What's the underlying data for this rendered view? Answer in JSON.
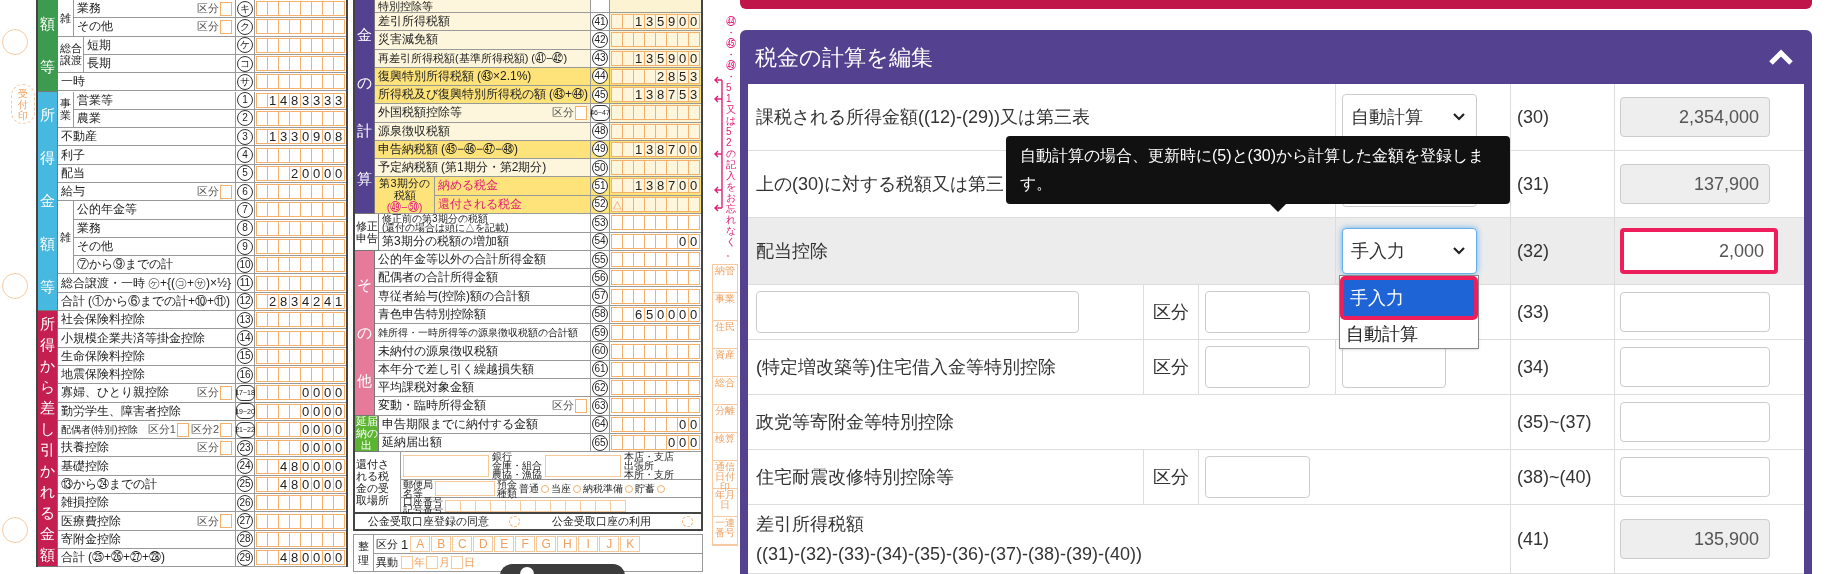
{
  "tax_return_form": {
    "receipt_stamp": "受付印",
    "column_1": [
      {
        "title": "額等",
        "color": "#3d9b4f",
        "kind": "plain",
        "rows": [
          {
            "kind": "group",
            "label": "雑",
            "rows": [
              {
                "kind": "row",
                "label": "業務",
                "kubun": "区分",
                "num": "キ"
              },
              {
                "kind": "row",
                "label": "その他",
                "kubun": "区分",
                "num": "ク"
              }
            ]
          },
          {
            "kind": "group",
            "label": "総合譲渡",
            "rows": [
              {
                "kind": "row",
                "label": "短期",
                "num": "ケ"
              },
              {
                "kind": "row",
                "label": "長期",
                "num": "コ"
              }
            ]
          },
          {
            "kind": "row",
            "label": "一時",
            "num": "サ"
          }
        ]
      },
      {
        "title": "所得金額等",
        "color": "#47b8e0",
        "kind": "plain",
        "rows": [
          {
            "kind": "group",
            "label": "事業",
            "rows": [
              {
                "kind": "row",
                "label": "営業等",
                "num": "1",
                "amount": "1483333"
              },
              {
                "kind": "row",
                "label": "農業",
                "num": "2"
              }
            ]
          },
          {
            "kind": "row",
            "label": "不動産",
            "num": "3",
            "amount": "1330908"
          },
          {
            "kind": "row",
            "label": "利子",
            "num": "4"
          },
          {
            "kind": "row",
            "label": "配当",
            "num": "5",
            "amount": "20000"
          },
          {
            "kind": "row",
            "label": "給与",
            "kubun": "区分",
            "num": "6"
          },
          {
            "kind": "group",
            "label": "雑",
            "rows": [
              {
                "kind": "row",
                "label": "公的年金等",
                "num": "7"
              },
              {
                "kind": "row",
                "label": "業務",
                "num": "8"
              },
              {
                "kind": "row",
                "label": "その他",
                "num": "9"
              },
              {
                "kind": "row",
                "label": "⑦から⑨までの計",
                "num": "10"
              }
            ]
          },
          {
            "kind": "row",
            "label": "総合譲渡・一時",
            "note": "㋘+{(㋙+㋚)×½}",
            "num": "11"
          },
          {
            "kind": "row",
            "label": "合計",
            "note": "(①から⑥までの計+⑩+⑪)",
            "num": "12",
            "amount": "2834241"
          }
        ]
      },
      {
        "title": "所得から差し引かれる金額",
        "color": "#c41f50",
        "kind": "plain",
        "rows": [
          {
            "kind": "row",
            "label": "社会保険料控除",
            "num": "13"
          },
          {
            "kind": "row",
            "label": "小規模企業共済等掛金控除",
            "num": "14"
          },
          {
            "kind": "row",
            "label": "生命保険料控除",
            "num": "15"
          },
          {
            "kind": "row",
            "label": "地震保険料控除",
            "num": "16"
          },
          {
            "kind": "row",
            "label": "寡婦、ひとり親控除",
            "kubun": "区分",
            "num": "17~18",
            "amount": "0000"
          },
          {
            "kind": "row",
            "label": "勤労学生、障害者控除",
            "num": "19~20",
            "amount": "0000"
          },
          {
            "kind": "row",
            "label": "配偶者(特別)控除",
            "kubun": "区分1",
            "kubun_2": "区分2",
            "num": "21~22",
            "amount": "0000"
          },
          {
            "kind": "row",
            "label": "扶養控除",
            "kubun": "区分",
            "num": "23",
            "amount": "0000"
          },
          {
            "kind": "row",
            "label": "基礎控除",
            "num": "24",
            "amount": "480000"
          },
          {
            "kind": "row",
            "label": "⑬から㉔までの計",
            "num": "25",
            "amount": "480000"
          },
          {
            "kind": "row",
            "label": "雑損控除",
            "num": "26"
          },
          {
            "kind": "row",
            "label": "医療費控除",
            "kubun": "区分",
            "num": "27"
          },
          {
            "kind": "row",
            "label": "寄附金控除",
            "num": "28"
          },
          {
            "kind": "row",
            "label": "合計",
            "note": "(㉕+㉖+㉗+㉘)",
            "num": "29",
            "amount": "480000"
          }
        ]
      }
    ],
    "column_2": [
      {
        "title": "金の計算",
        "color": "#54418f",
        "kind": "tax",
        "rows": [
          {
            "kind": "partial",
            "label": "特別控除等"
          },
          {
            "kind": "row",
            "label": "差引所得税額",
            "num": "41",
            "amount": "135900"
          },
          {
            "kind": "row",
            "label": "災害減免額",
            "num": "42"
          },
          {
            "kind": "row",
            "label": "再差引所得税額(基準所得税額)",
            "note": "(㊶−㊷)",
            "num": "43",
            "amount": "135900"
          },
          {
            "kind": "row",
            "label": "復興特別所得税額",
            "note": "(㊸×2.1%)",
            "num": "44",
            "amount": "2853",
            "highlight": true
          },
          {
            "kind": "row",
            "label": "所得税及び復興特別所得税の額",
            "note": "(㊸+㊹)",
            "num": "45",
            "amount": "138753",
            "highlight": true
          },
          {
            "kind": "row",
            "label": "外国税額控除等",
            "kubun": "区分",
            "num": "46~47"
          },
          {
            "kind": "row",
            "label": "源泉徴収税額",
            "num": "48"
          },
          {
            "kind": "row",
            "label": "申告納税額",
            "note": "(㊺−㊻−㊼−㊽)",
            "num": "49",
            "amount": "138700",
            "highlight": true
          },
          {
            "kind": "row",
            "label": "予定納税額",
            "note": "(第1期分・第2期分)",
            "num": "50"
          },
          {
            "kind": "group",
            "label": "第3期分の税額",
            "note": "(㊾−㊿)",
            "highlight": true,
            "rows": [
              {
                "kind": "row",
                "label": "納める税金",
                "num": "51",
                "amount": "138700",
                "highlight": true
              },
              {
                "kind": "row",
                "label": "還付される税金",
                "num": "52",
                "prefix": "△",
                "highlight": true
              }
            ]
          }
        ]
      },
      {
        "title": "修正申告",
        "color": "#ffffff",
        "kind": "plain",
        "rows": [
          {
            "kind": "row",
            "label": "修正前の第3期分の税額",
            "note": "(還付の場合は頭に△を記載)",
            "num": "53"
          },
          {
            "kind": "row",
            "label": "第3期分の税額の増加額",
            "num": "54",
            "amount": "00"
          }
        ]
      },
      {
        "title": "その他",
        "color": "#e57a9b",
        "kind": "plain",
        "rows": [
          {
            "kind": "row",
            "label": "公的年金等以外の合計所得金額",
            "num": "55"
          },
          {
            "kind": "row",
            "label": "配偶者の合計所得金額",
            "num": "56"
          },
          {
            "kind": "row",
            "label": "専従者給与(控除)額の合計額",
            "num": "57"
          },
          {
            "kind": "row",
            "label": "青色申告特別控除額",
            "num": "58",
            "amount": "650000"
          },
          {
            "kind": "row",
            "label": "雑所得・一時所得等の源泉徴収税額の合計額",
            "num": "59"
          },
          {
            "kind": "row",
            "label": "未納付の源泉徴収税額",
            "num": "60"
          },
          {
            "kind": "row",
            "label": "本年分で差し引く繰越損失額",
            "num": "61"
          },
          {
            "kind": "row",
            "label": "平均課税対象金額",
            "num": "62"
          },
          {
            "kind": "row",
            "label": "変動・臨時所得金額",
            "kubun": "区分",
            "num": "63"
          }
        ]
      },
      {
        "title": "延届納の出",
        "color": "#5cb531",
        "kind": "plain",
        "rows": [
          {
            "kind": "row",
            "label": "申告期限までに納付する金額",
            "num": "64",
            "amount": "00"
          },
          {
            "kind": "row",
            "label": "延納届出額",
            "num": "65",
            "amount": "000"
          }
        ]
      }
    ],
    "reminder_note": "㊹・㊺・㊾・51又は52の記入をお忘れなく。",
    "margin_labels": [
      "納管",
      "事業",
      "住民",
      "資産",
      "総合",
      "分離",
      "検算",
      "通信日付印",
      "年月日",
      "一連番号"
    ],
    "refund_account": {
      "title": "還付される税金の受取場所",
      "bank_label": [
        "銀行",
        "金庫・組合",
        "農協・漁協"
      ],
      "branch_label": [
        "本店・支店",
        "出張所",
        "本所・支所"
      ],
      "post_office_label": [
        "郵便局",
        "名等"
      ],
      "deposit_label": [
        "預金",
        "種類"
      ],
      "deposit_types": [
        "普通",
        "当座",
        "納税準備",
        "貯蓄"
      ],
      "account_number_label": [
        "口座番号",
        "記号番号"
      ]
    },
    "public_account": [
      {
        "label": "公金受取口座登録の同意"
      },
      {
        "label": "公金受取口座の利用"
      }
    ],
    "office_use": {
      "title": "整理",
      "category_label": "区分",
      "category_value": "1",
      "codes": [
        "A",
        "B",
        "C",
        "D",
        "E",
        "F",
        "G",
        "H",
        "I",
        "J",
        "K"
      ],
      "change_label": "異動",
      "date_units": [
        "年",
        "月",
        "日"
      ]
    }
  },
  "edit_panel": {
    "title": "税金の計算を編集",
    "expanded": true,
    "tooltip": {
      "text": "自動計算の場合、更新時に(5)と(30)から計算した金額を登録します。"
    },
    "rows": [
      {
        "kind": "text",
        "label": "課税される所得金額((12)-(29))又は第三表",
        "shaded": false,
        "mode": {
          "value": "自動計算",
          "focused": false
        },
        "number": "(30)",
        "amount": {
          "value": "2,354,000",
          "readonly": true,
          "annotated": false
        }
      },
      {
        "kind": "text",
        "label": "上の(30)に対する税額又は第三",
        "shaded": false,
        "mode": {
          "focused": false
        },
        "number": "(31)",
        "amount": {
          "value": "137,900",
          "readonly": true,
          "annotated": false
        }
      },
      {
        "kind": "text",
        "label": "配当控除",
        "shaded": true,
        "mode": {
          "value": "手入力",
          "focused": true,
          "open": true,
          "options": [
            {
              "label": "手入力",
              "selected": true,
              "annotated": true
            },
            {
              "label": "自動計算",
              "selected": false,
              "annotated": false
            }
          ]
        },
        "number": "(32)",
        "amount": {
          "value": "2,000",
          "readonly": false,
          "annotated": true
        }
      },
      {
        "kind": "input",
        "shaded": false,
        "kubun": "区分",
        "number": "(33)",
        "amount": {
          "readonly": false,
          "annotated": false
        }
      },
      {
        "kind": "text",
        "label": "(特定増改築等)住宅借入金等特別控除",
        "shaded": false,
        "kubun": "区分",
        "extra_input": true,
        "number": "(34)",
        "amount": {
          "readonly": false,
          "annotated": false
        }
      },
      {
        "kind": "text",
        "label": "政党等寄附金等特別控除",
        "shaded": false,
        "number": "(35)~(37)",
        "amount": {
          "readonly": false,
          "annotated": false
        }
      },
      {
        "kind": "text",
        "label": "住宅耐震改修特別控除等",
        "shaded": false,
        "kubun": "区分",
        "number": "(38)~(40)",
        "amount": {
          "readonly": false,
          "annotated": false
        }
      },
      {
        "kind": "text",
        "label": "差引所得税額",
        "note": "((31)-(32)-(33)-(34)-(35)-(36)-(37)-(38)-(39)-(40))",
        "shaded": false,
        "number": "(41)",
        "amount": {
          "value": "135,900",
          "readonly": true,
          "annotated": false
        }
      }
    ]
  }
}
